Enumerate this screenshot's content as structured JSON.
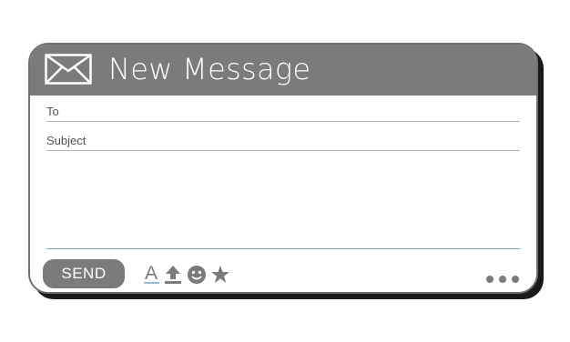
{
  "header": {
    "title": "New Message"
  },
  "fields": {
    "to_label": "To",
    "subject_label": "Subject"
  },
  "toolbar": {
    "send_label": "SEND",
    "icons": [
      "font-icon",
      "upload-icon",
      "emoji-icon",
      "star-icon",
      "more-icon"
    ]
  },
  "colors": {
    "header_bg": "#7b7b7b",
    "button_bg": "#7b7b7b",
    "text_on_dark": "#ffffff",
    "shadow": "#1a1a1a",
    "input_underline": "#7aa6cc"
  }
}
